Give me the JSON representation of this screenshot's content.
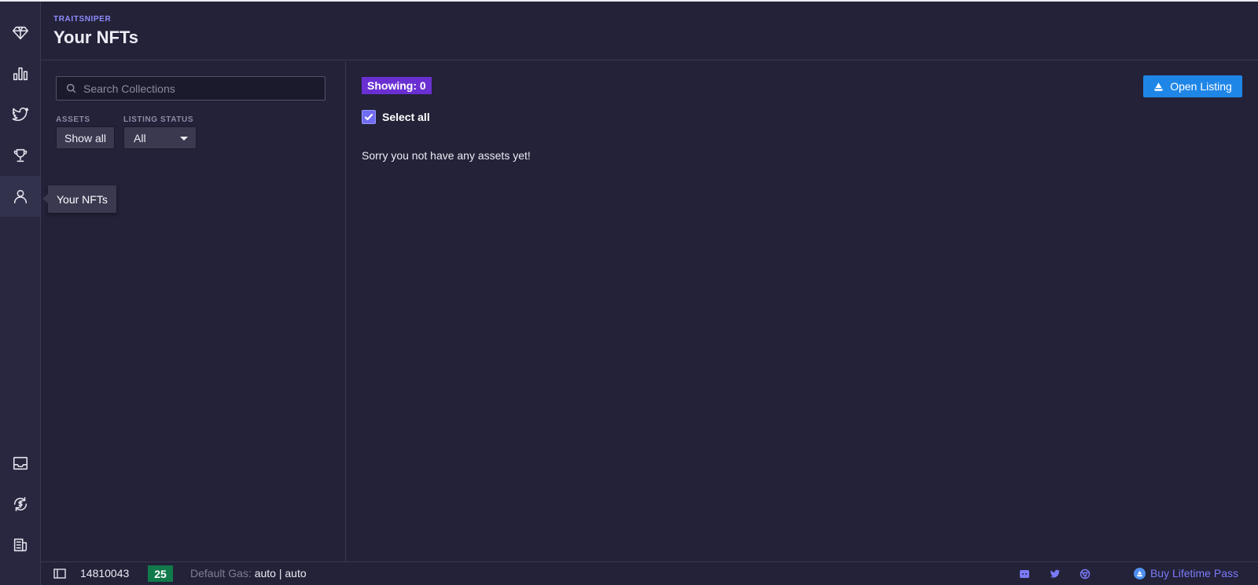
{
  "app": {
    "brand": "TRAITSNIPER",
    "page_title": "Your NFTs"
  },
  "rail": {
    "items": [
      {
        "icon": "diamond-icon"
      },
      {
        "icon": "bar-chart-icon"
      },
      {
        "icon": "twitter-icon"
      },
      {
        "icon": "trophy-icon"
      },
      {
        "icon": "user-icon",
        "active": true
      },
      {
        "icon": "inbox-icon"
      },
      {
        "icon": "swap-icon"
      },
      {
        "icon": "news-icon"
      }
    ],
    "tooltip": "Your NFTs"
  },
  "filters": {
    "search_placeholder": "Search Collections",
    "assets_label": "ASSETS",
    "assets_value": "Show all",
    "listing_status_label": "LISTING STATUS",
    "listing_status_value": "All"
  },
  "main": {
    "showing_badge": "Showing: 0",
    "open_listing_label": "Open Listing",
    "select_all_label": "Select all",
    "select_all_checked": true,
    "empty_message": "Sorry you not have any assets yet!"
  },
  "statusbar": {
    "block_number": "14810043",
    "gas_price": "25",
    "default_gas_label": "Default Gas:",
    "default_gas_value": "auto | auto",
    "buy_pass_label": "Buy Lifetime Pass"
  },
  "colors": {
    "background": "#232238",
    "accent": "#6f6cf0",
    "badge_purple": "#6a2fd2",
    "button_blue": "#1f86e8",
    "gas_green": "#117a4b",
    "link_purple": "#7c7af9"
  }
}
